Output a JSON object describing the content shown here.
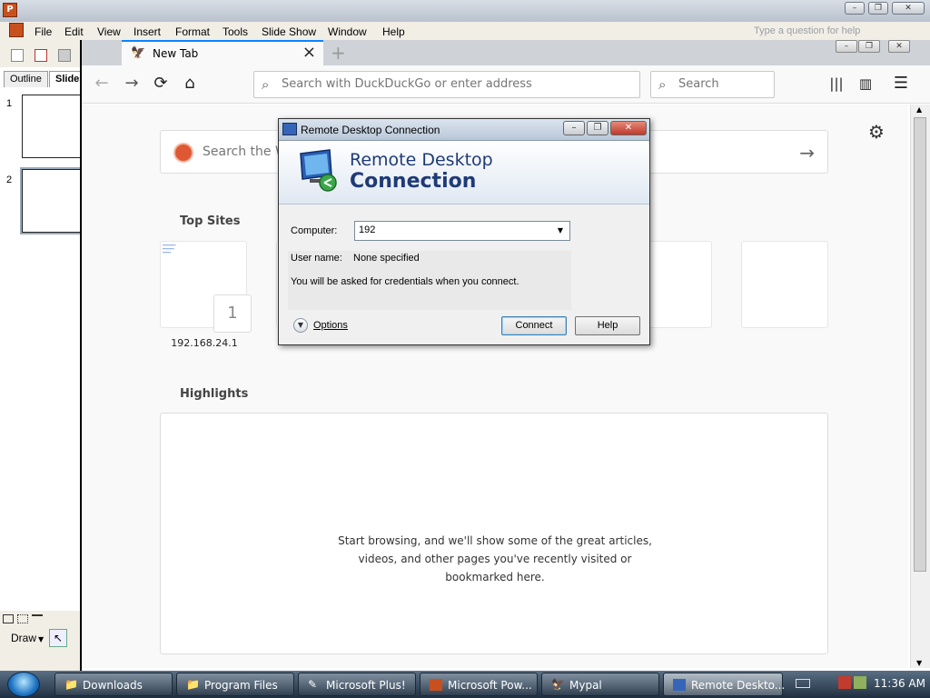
{
  "powerpoint": {
    "menu": [
      "File",
      "Edit",
      "View",
      "Insert",
      "Format",
      "Tools",
      "Slide Show",
      "Window",
      "Help"
    ],
    "help_placeholder": "Type a question for help",
    "tabs": [
      "Outline",
      "Slides"
    ],
    "slides": [
      "1",
      "2"
    ],
    "draw_label": "Draw"
  },
  "firefox": {
    "tab_title": "New Tab",
    "url_placeholder": "Search with DuckDuckGo or enter address",
    "search_placeholder": "Search",
    "web_search_placeholder": "Search the W",
    "top_sites_title": "Top Sites",
    "top_sites": [
      {
        "label": "192.168.24.1",
        "number": "1"
      }
    ],
    "highlights_title": "Highlights",
    "highlights_message": "Start browsing, and we'll show some of the great articles, videos, and other pages you've recently visited or bookmarked here."
  },
  "rdp_dialog": {
    "title": "Remote Desktop Connection",
    "brand_line1": "Remote Desktop",
    "brand_line2": "Connection",
    "computer_label": "Computer:",
    "computer_value": "192",
    "username_label": "User name:",
    "username_value": "None specified",
    "info_text": "You will be asked for credentials when you connect.",
    "options_label": "Options",
    "connect_label": "Connect",
    "help_label": "Help"
  },
  "taskbar": {
    "items": [
      {
        "label": "Downloads",
        "icon": "folder-icon",
        "active": false
      },
      {
        "label": "Program Files",
        "icon": "folder-icon",
        "active": false
      },
      {
        "label": "Microsoft Plus!",
        "icon": "program-icon",
        "active": false
      },
      {
        "label": "Microsoft Pow...",
        "icon": "powerpoint-icon",
        "active": false
      },
      {
        "label": "Mypal",
        "icon": "mypal-icon",
        "active": false
      },
      {
        "label": "Remote Deskto...",
        "icon": "rdp-icon",
        "active": true
      }
    ],
    "clock": "11:36 AM"
  },
  "colors": {
    "firefox_accent": "#0a84ff",
    "rdp_brand": "#1f3b76",
    "taskbar": "#2a3d52"
  }
}
